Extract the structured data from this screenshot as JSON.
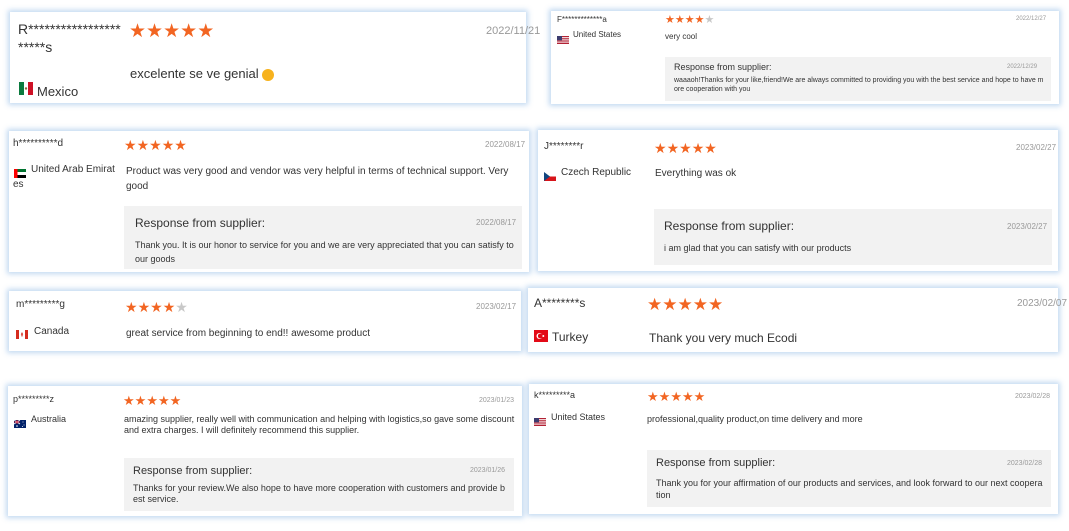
{
  "reviews": [
    {
      "name": "R**********************s",
      "country": "Mexico",
      "flag": "mexico-flag",
      "rating": 5,
      "date": "2022/11/21",
      "text": "excelente se ve genial"
    },
    {
      "name": "F*************a",
      "country": "United States",
      "flag": "united-states-flag",
      "rating": 4,
      "date": "2022/12/27",
      "text": "very cool",
      "response": {
        "title": "Response from supplier:",
        "date": "2022/12/29",
        "text": "waaaoh!Thanks for your like,friend!We are always committed to providing you with the best service and hope to have more cooperation with you"
      }
    },
    {
      "name": "h**********d",
      "country": "United Arab Emirates",
      "flag": "uae-flag",
      "rating": 5,
      "date": "2022/08/17",
      "text": "Product was very good and vendor was very helpful in terms of technical support. Very good",
      "response": {
        "title": "Response from supplier:",
        "date": "2022/08/17",
        "text": "Thank you. It is our honor to service for you and we are very appreciated that you can satisfy to our goods"
      }
    },
    {
      "name": "J********r",
      "country": "Czech Republic",
      "flag": "czech-flag",
      "rating": 5,
      "date": "2023/02/27",
      "text": "Everything was ok",
      "response": {
        "title": "Response from supplier:",
        "date": "2023/02/27",
        "text": "i am glad that you can satisfy with our products"
      }
    },
    {
      "name": "m*********g",
      "country": "Canada",
      "flag": "canada-flag",
      "rating": 4,
      "date": "2023/02/17",
      "text": "great service from beginning to end!! awesome product"
    },
    {
      "name": "A********s",
      "country": "Turkey",
      "flag": "turkey-flag",
      "rating": 5,
      "date": "2023/02/07",
      "text": "Thank you very much Ecodi"
    },
    {
      "name": "p*********z",
      "country": "Australia",
      "flag": "australia-flag",
      "rating": 5,
      "date": "2023/01/23",
      "text": "amazing supplier, really well with communication and helping with logistics,so gave some discount and extra charges. I will definitely recommend this supplier.",
      "response": {
        "title": "Response from supplier:",
        "date": "2023/01/26",
        "text": "Thanks for your review.We also hope to have more cooperation with customers and provide best service."
      }
    },
    {
      "name": "k*********a",
      "country": "United States",
      "flag": "united-states-flag",
      "rating": 5,
      "date": "2023/02/28",
      "text": "professional,quality product,on time delivery and more",
      "response": {
        "title": "Response from supplier:",
        "date": "2023/02/28",
        "text": "Thank you for your affirmation of our products and services, and look forward to our next cooperation"
      }
    }
  ]
}
